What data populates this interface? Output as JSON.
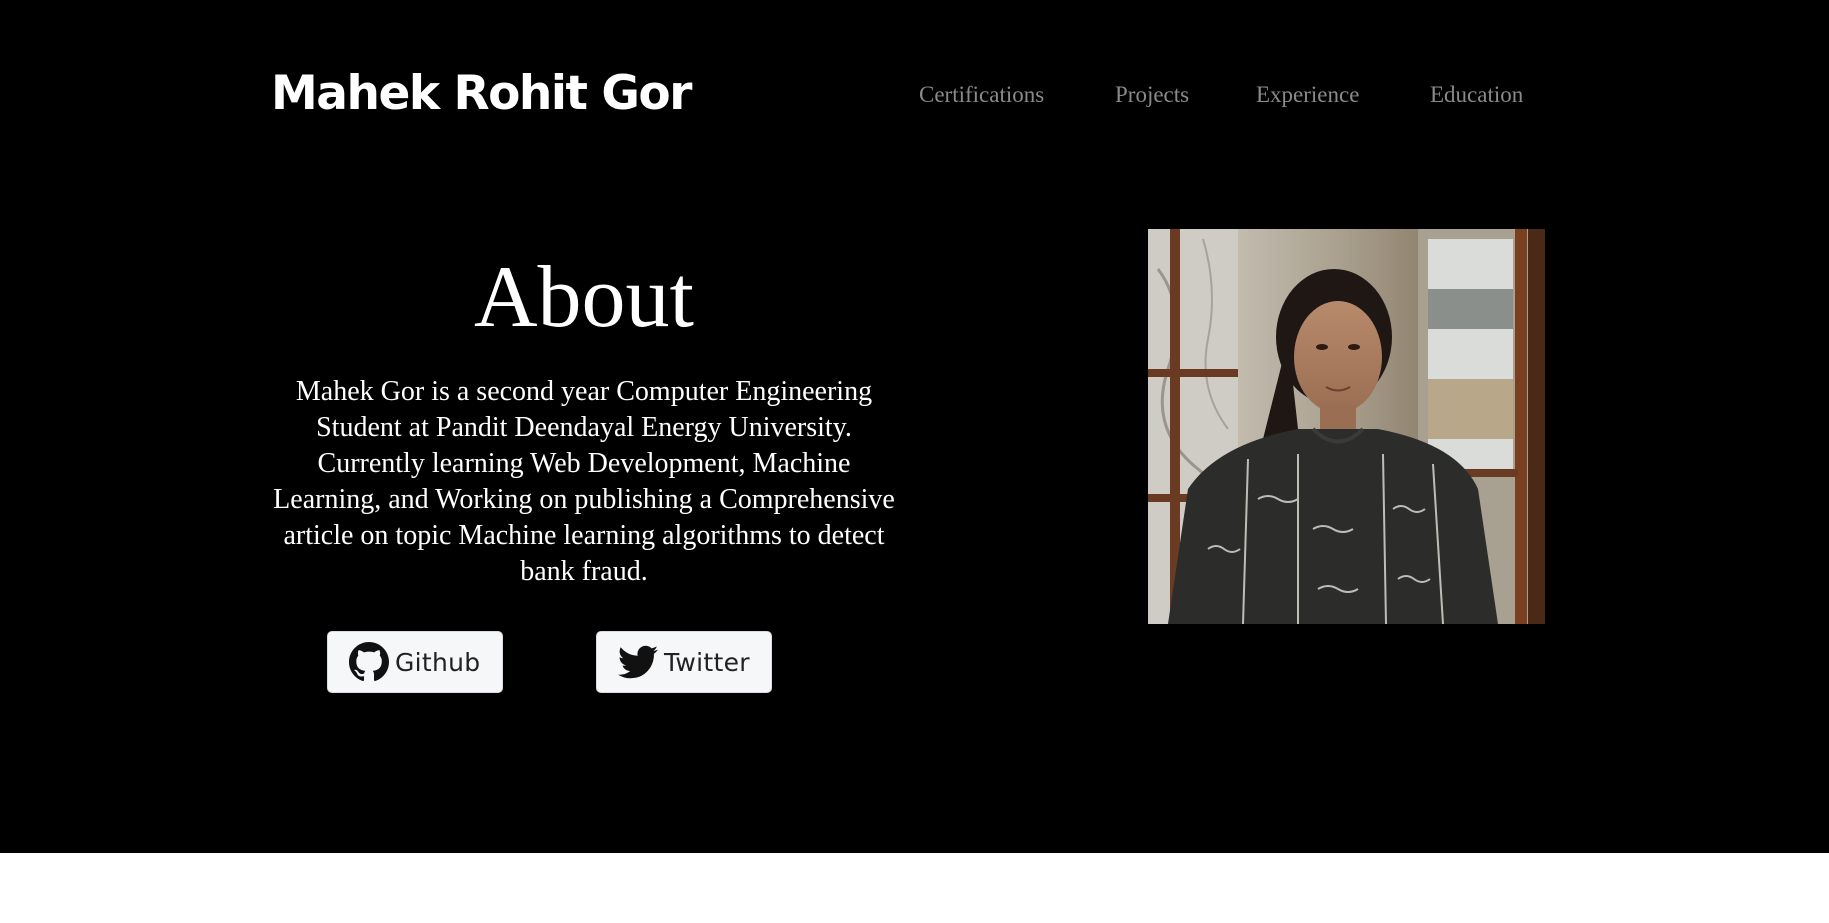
{
  "header": {
    "brand": "Mahek Rohit Gor",
    "nav": [
      {
        "label": "Certifications"
      },
      {
        "label": "Projects"
      },
      {
        "label": "Experience"
      },
      {
        "label": "Education"
      }
    ]
  },
  "about": {
    "title": "About",
    "text": "Mahek Gor is a second year Computer Engineering Student at Pandit Deendayal Energy University. Currently learning Web Development, Machine Learning, and Working on publishing a Comprehensive article on topic Machine learning algorithms to detect bank fraud.",
    "buttons": [
      {
        "label": "Github",
        "icon": "github-icon"
      },
      {
        "label": "Twitter",
        "icon": "twitter-icon"
      }
    ]
  },
  "colors": {
    "hero_bg": "#000000",
    "nav_text": "#8a8a8a",
    "button_bg": "#f6f7f9",
    "page_bg": "#ffffff"
  }
}
